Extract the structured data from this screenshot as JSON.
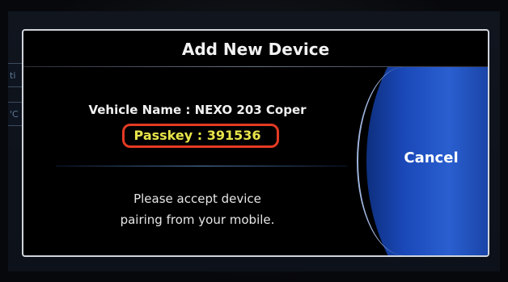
{
  "background": {
    "tab1_label": "ti",
    "tab2_label": "'C"
  },
  "dialog": {
    "title": "Add New Device",
    "vehicle_name": "Vehicle Name : NEXO 203 Coper",
    "passkey": "Passkey : 391536",
    "message_line1": "Please accept device",
    "message_line2": "pairing from your mobile.",
    "cancel_label": "Cancel"
  },
  "colors": {
    "passkey_text": "#e8e44a",
    "highlight_box": "#e53a24",
    "cancel_button": "#1a48b8"
  }
}
